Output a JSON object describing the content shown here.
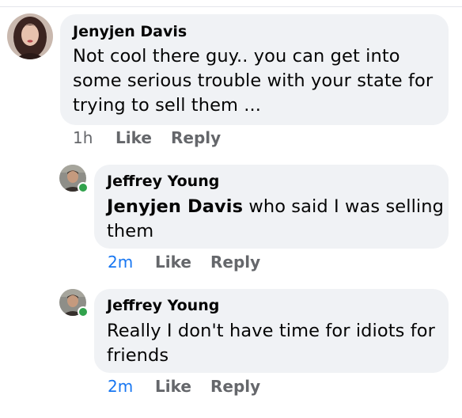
{
  "comments": [
    {
      "author": "Jenyjen Davis",
      "line1": "Not cool there guy.. you can get into",
      "line2": "some serious trouble with your state for",
      "line3": "trying to sell them ...",
      "time": "1h",
      "like_label": "Like",
      "reply_label": "Reply",
      "avatar_icon": "profile-photo-woman"
    },
    {
      "author": "Jeffrey Young",
      "mention": "Jenyjen Davis",
      "line1_rest": " who said I was selling",
      "line2": "them",
      "time": "2m",
      "like_label": "Like",
      "reply_label": "Reply",
      "avatar_icon": "profile-photo-man",
      "online": true
    },
    {
      "author": "Jeffrey Young",
      "line1": "Really I don't have time for idiots for",
      "line2": "friends",
      "time": "2m",
      "like_label": "Like",
      "reply_label": "Reply",
      "avatar_icon": "profile-photo-man",
      "online": true
    }
  ],
  "colors": {
    "bubble_bg": "#f0f2f5",
    "meta_gray": "#65676b",
    "recent_time_blue": "#1877f2",
    "online_green": "#31a24c"
  }
}
